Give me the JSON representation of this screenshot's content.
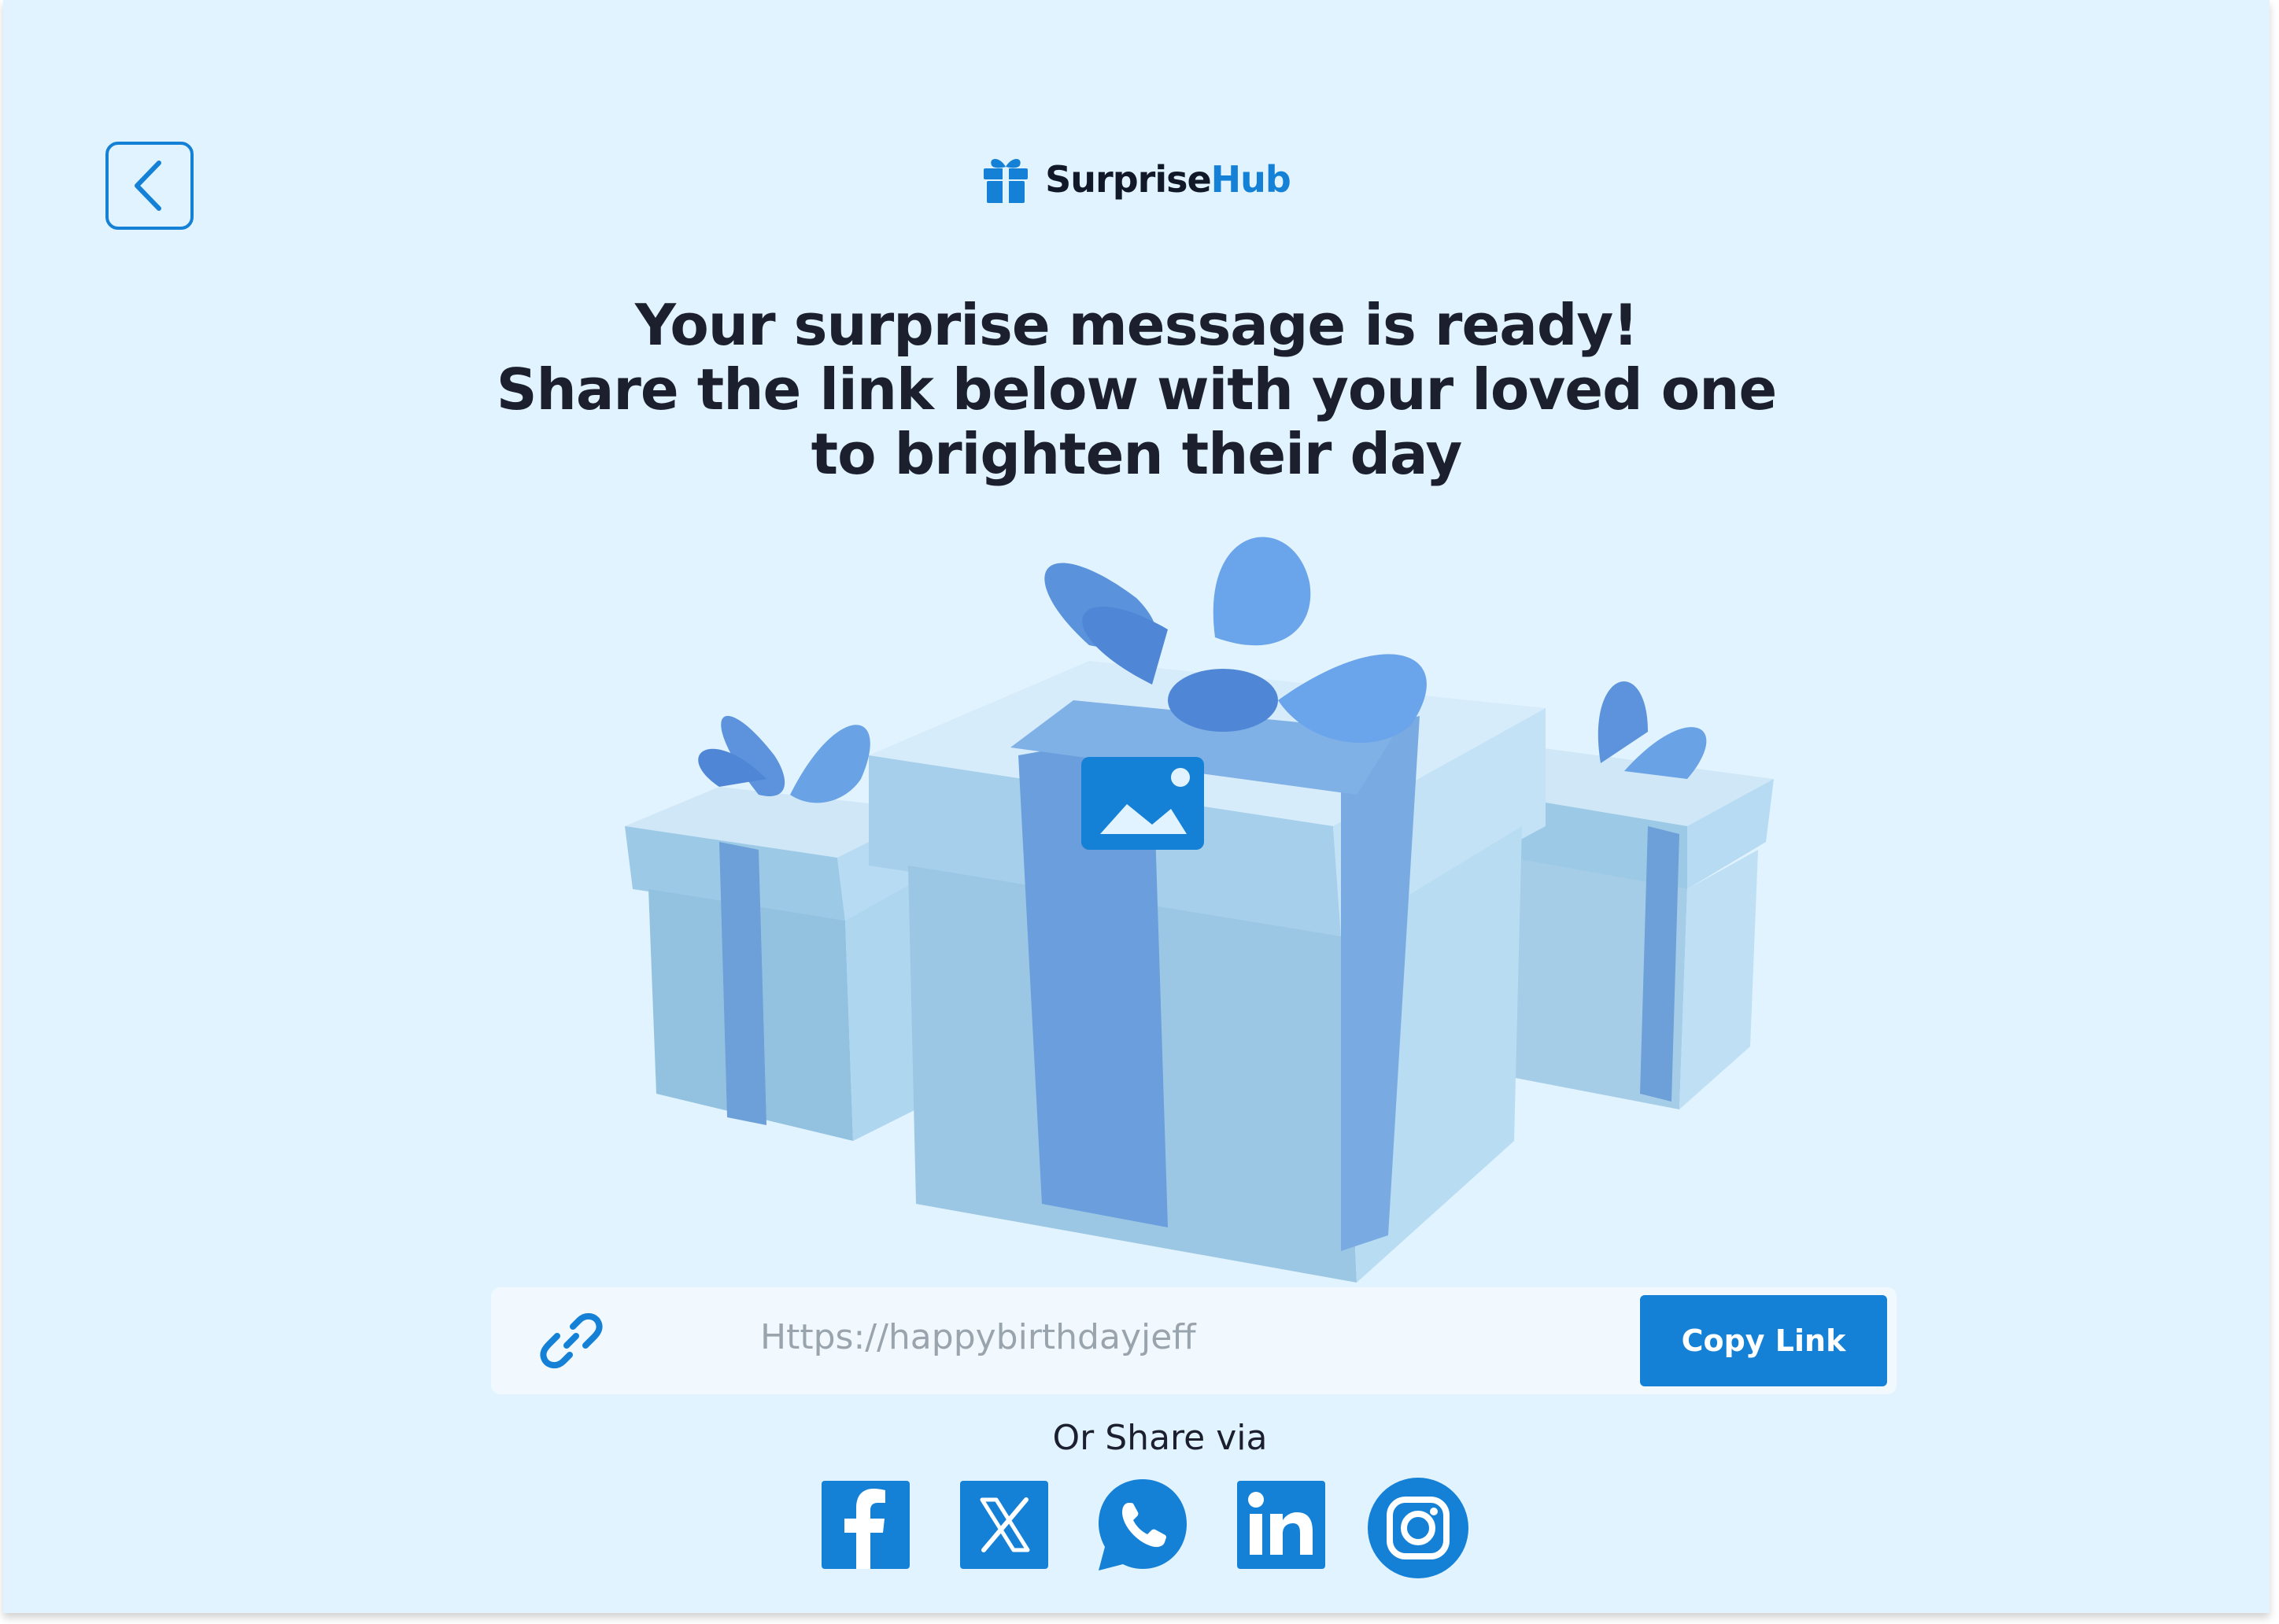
{
  "brand": {
    "name_part1": "Surprise",
    "name_part2": "Hub",
    "accent_color": "#1581d6",
    "icon": "gift-icon"
  },
  "back_button": {
    "icon": "chevron-left-icon"
  },
  "headline": {
    "line1": "Your surprise message is ready!",
    "line2": "Share the link below with your loved one",
    "line3": "to brighten their day"
  },
  "illustration": {
    "icon": "image-icon"
  },
  "share_link": {
    "icon": "link-icon",
    "url": "Https://happybirthdayjeff",
    "copy_label": "Copy Link"
  },
  "share_via": {
    "label": "Or Share via",
    "networks": [
      {
        "name": "facebook",
        "icon": "facebook-icon"
      },
      {
        "name": "x",
        "icon": "x-icon"
      },
      {
        "name": "whatsapp",
        "icon": "whatsapp-icon"
      },
      {
        "name": "linkedin",
        "icon": "linkedin-icon"
      },
      {
        "name": "instagram",
        "icon": "instagram-icon"
      }
    ]
  },
  "colors": {
    "background": "#e1f3fe",
    "primary": "#1581d6",
    "text": "#1b1f2e"
  }
}
